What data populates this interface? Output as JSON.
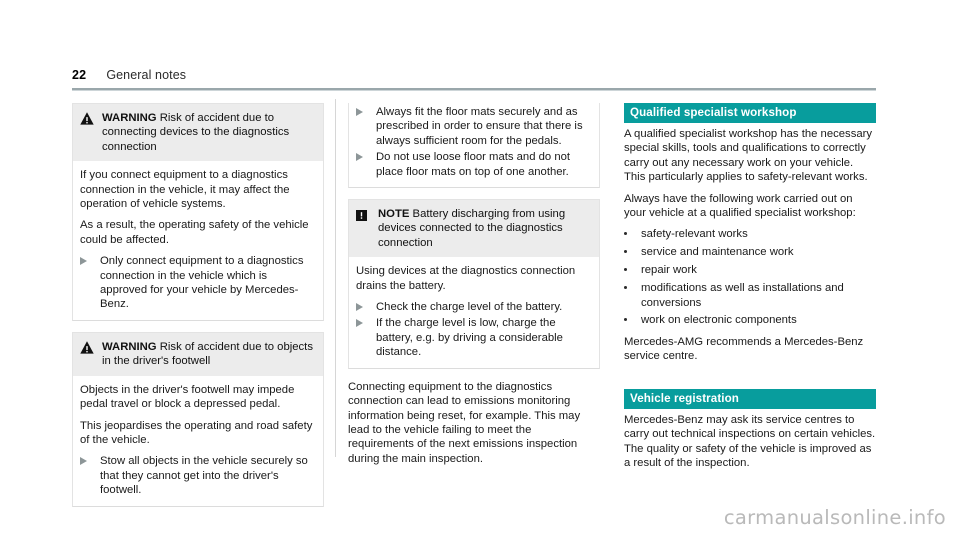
{
  "header": {
    "page_number": "22",
    "title": "General notes"
  },
  "icons": {
    "warning": "warning-triangle-icon",
    "note": "note-exclamation-icon",
    "action_arrow": "action-arrow-icon",
    "bullet": "bullet-dot-icon"
  },
  "colors": {
    "teal_header": "#089d9d",
    "box_header_bg": "#ececec",
    "rule": "#9aa7ab",
    "arrow": "#8d9698",
    "watermark": "#b9b9b9"
  },
  "column1": {
    "warning1": {
      "label": "WARNING",
      "title": "Risk of accident due to connecting devices to the diagnostics connection",
      "paragraphs": [
        "If you connect equipment to a diagnostics connection in the vehicle, it may affect the operation of vehicle systems.",
        "As a result, the operating safety of the vehicle could be affected."
      ],
      "actions": [
        "Only connect equipment to a diagnostics connection in the vehicle which is approved for your vehicle by Mercedes-Benz."
      ]
    },
    "warning2": {
      "label": "WARNING",
      "title": "Risk of accident due to objects in the driver's footwell",
      "paragraphs": [
        "Objects in the driver's footwell may impede pedal travel or block a depressed pedal.",
        "This jeopardises the operating and road safety of the vehicle."
      ],
      "actions": [
        "Stow all objects in the vehicle securely so that they cannot get into the driver's footwell."
      ]
    }
  },
  "column2": {
    "continued_actions": [
      "Always fit the floor mats securely and as prescribed in order to ensure that there is always sufficient room for the pedals.",
      "Do not use loose floor mats and do not place floor mats on top of one another."
    ],
    "note": {
      "label": "NOTE",
      "title": "Battery discharging from using devices connected to the diagnostics connection",
      "paragraphs": [
        "Using devices at the diagnostics connection drains the battery."
      ],
      "actions": [
        "Check the charge level of the battery.",
        "If the charge level is low, charge the battery, e.g. by driving a considerable distance."
      ]
    },
    "closing_paragraph": "Connecting equipment to the diagnostics connection can lead to emissions monitoring information being reset, for example. This may lead to the vehicle failing to meet the requirements of the next emissions inspection during the main inspection."
  },
  "column3": {
    "section1": {
      "heading": "Qualified specialist workshop",
      "paragraphs": [
        "A qualified specialist workshop has the necessary special skills, tools and qualifications to correctly carry out any necessary work on your vehicle. This particularly applies to safety-relevant works.",
        "Always have the following work carried out on your vehicle at a qualified specialist workshop:"
      ],
      "bullets": [
        "safety-relevant works",
        "service and maintenance work",
        "repair work",
        "modifications as well as installations and conversions",
        "work on electronic components"
      ],
      "closing_paragraph": "Mercedes-AMG recommends a Mercedes-Benz service centre."
    },
    "section2": {
      "heading": "Vehicle registration",
      "paragraphs": [
        "Mercedes-Benz may ask its service centres to carry out technical inspections on certain vehicles. The quality or safety of the vehicle is improved as a result of the inspection."
      ]
    }
  },
  "watermark": "carmanualsonline.info"
}
